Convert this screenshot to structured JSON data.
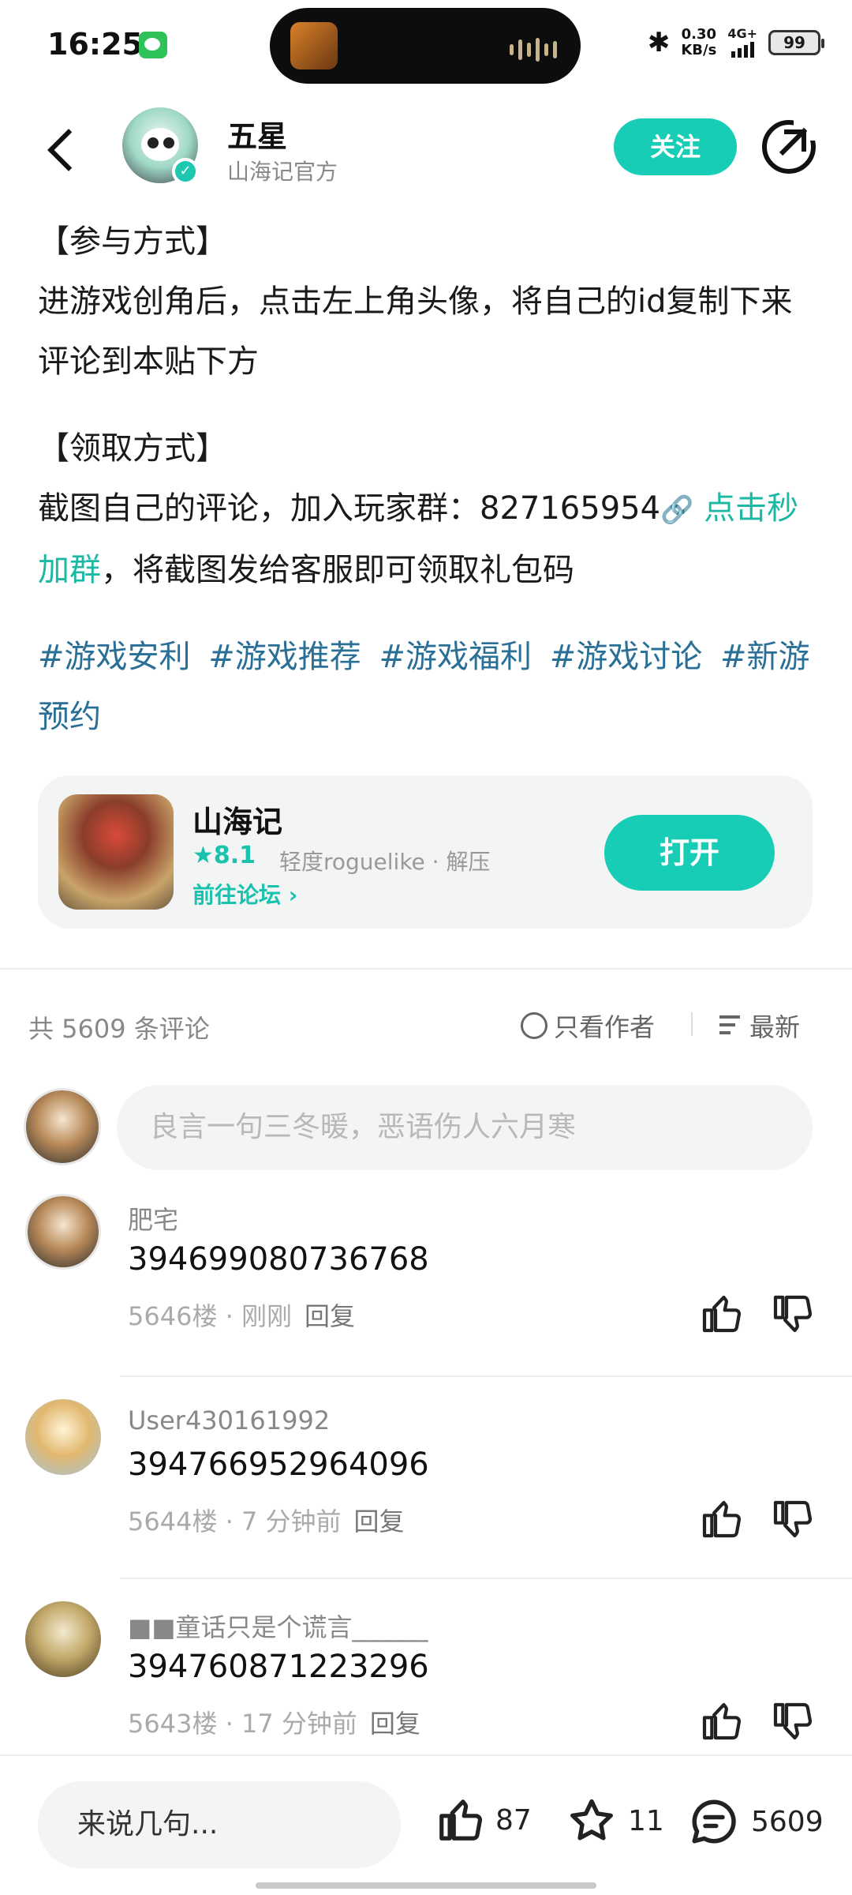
{
  "status_bar": {
    "time": "16:25",
    "net_speed_value": "0.30",
    "net_speed_unit": "KB/s",
    "network": "4G+",
    "battery": "99"
  },
  "header": {
    "author_name": "五星",
    "author_sub": "山海记官方",
    "follow_label": "关注"
  },
  "post": {
    "section1_title": "【参与方式】",
    "section1_body": "进游戏创角后，点击左上角头像，将自己的id复制下来评论到本贴下方",
    "section2_title": "【领取方式】",
    "section2_prefix": "截图自己的评论，加入玩家群：827165954",
    "section2_link": "点击秒加群",
    "section2_suffix": "，将截图发给客服即可领取礼包码",
    "tags": [
      "#游戏安利",
      "#游戏推荐",
      "#游戏福利",
      "#游戏讨论",
      "#新游预约"
    ]
  },
  "game_card": {
    "name": "山海记",
    "rating": "8.1",
    "tags": "轻度roguelike · 解压",
    "forum_link": "前往论坛",
    "open_label": "打开"
  },
  "comments_header": {
    "count_text": "共 5609 条评论",
    "author_only": "只看作者",
    "sort_label": "最新"
  },
  "comment_input": {
    "placeholder": "良言一句三冬暖，恶语伤人六月寒"
  },
  "comments": [
    {
      "user": "肥宅",
      "text": "394699080736768",
      "floor": "5646楼",
      "time": "刚刚",
      "reply": "回复"
    },
    {
      "user": "User430161992",
      "text": "394766952964096",
      "floor": "5644楼",
      "time": "7 分钟前",
      "reply": "回复"
    },
    {
      "user": "■■童话只是个谎言______",
      "text": "394760871223296",
      "floor": "5643楼",
      "time": "17 分钟前",
      "reply": "回复"
    }
  ],
  "bottom_bar": {
    "input_placeholder": "来说几句...",
    "likes": "87",
    "favorites": "11",
    "comments": "5609"
  },
  "colors": {
    "accent": "#18cdb6",
    "tag_link": "#2a6f96"
  }
}
